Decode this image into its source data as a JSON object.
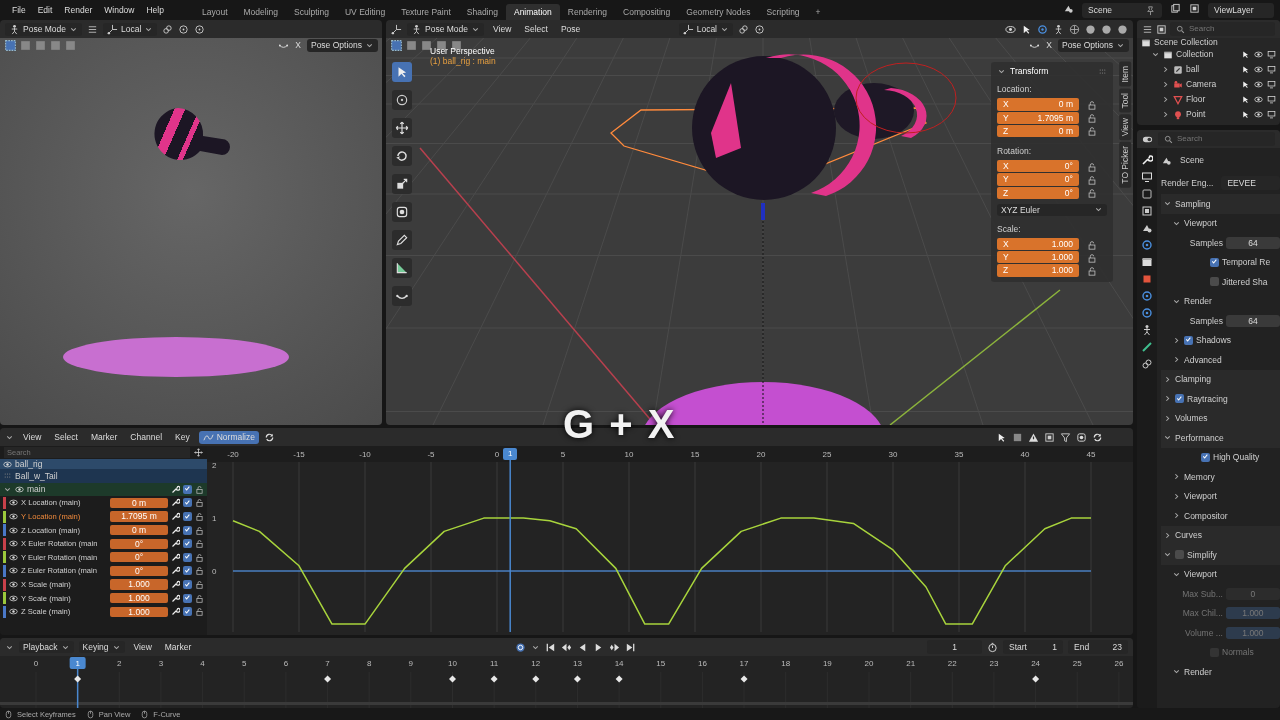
{
  "menu": [
    "File",
    "Edit",
    "Render",
    "Window",
    "Help"
  ],
  "workspaces": [
    {
      "label": "Layout",
      "selected": false
    },
    {
      "label": "Modeling",
      "selected": false
    },
    {
      "label": "Sculpting",
      "selected": false
    },
    {
      "label": "UV Editing",
      "selected": false
    },
    {
      "label": "Texture Paint",
      "selected": false
    },
    {
      "label": "Shading",
      "selected": false
    },
    {
      "label": "Animation",
      "selected": true
    },
    {
      "label": "Rendering",
      "selected": false
    },
    {
      "label": "Compositing",
      "selected": false
    },
    {
      "label": "Geometry Nodes",
      "selected": false
    },
    {
      "label": "Scripting",
      "selected": false
    }
  ],
  "add_workspace": "+",
  "scene": "Scene",
  "view_layer": "ViewLayer",
  "left_viewport": {
    "mode": "Pose Mode",
    "orientation": "Local",
    "mirror": "X",
    "pose_options": "Pose Options"
  },
  "main_viewport": {
    "mode": "Pose Mode",
    "menus": [
      "View",
      "Select",
      "Pose"
    ],
    "orientation": "Local",
    "mirror": "X",
    "pose_options": "Pose Options",
    "view_name": "User Perspective",
    "object_label": "(1) ball_rig : main",
    "side_tabs": [
      "Item",
      "Tool",
      "View",
      "TO Picker"
    ],
    "transform": {
      "title": "Transform",
      "groups": [
        {
          "label": "Location:",
          "fields": [
            {
              "axis": "X",
              "value": "0 m"
            },
            {
              "axis": "Y",
              "value": "1.7095 m"
            },
            {
              "axis": "Z",
              "value": "0 m"
            }
          ]
        },
        {
          "label": "Rotation:",
          "fields": [
            {
              "axis": "X",
              "value": "0°"
            },
            {
              "axis": "Y",
              "value": "0°"
            },
            {
              "axis": "Z",
              "value": "0°"
            }
          ],
          "mode": "XYZ Euler"
        },
        {
          "label": "Scale:",
          "fields": [
            {
              "axis": "X",
              "value": "1.000"
            },
            {
              "axis": "Y",
              "value": "1.000"
            },
            {
              "axis": "Z",
              "value": "1.000"
            }
          ]
        }
      ]
    }
  },
  "outliner": {
    "search_placeholder": "Search",
    "tree": [
      {
        "label": "Scene Collection",
        "kind": "scene_collection",
        "children": [
          {
            "label": "Collection",
            "kind": "collection",
            "expanded": true,
            "children": [
              {
                "label": "ball",
                "kind": "armature",
                "expanded": false
              },
              {
                "label": "Camera",
                "kind": "camera",
                "expanded": false
              },
              {
                "label": "Floor",
                "kind": "mesh",
                "expanded": false
              },
              {
                "label": "Point",
                "kind": "light",
                "expanded": false
              }
            ]
          }
        ]
      }
    ]
  },
  "properties": {
    "search_placeholder": "Search",
    "context": "Scene",
    "render_engine_label": "Render Eng...",
    "render_engine": "EEVEE",
    "panels": [
      {
        "kind": "panel",
        "label": "Sampling",
        "expanded": true,
        "children": [
          {
            "kind": "panel",
            "label": "Viewport",
            "expanded": true,
            "children": [
              {
                "kind": "field",
                "label": "Samples",
                "value": "64"
              },
              {
                "kind": "check",
                "label": "Temporal Re",
                "checked": true
              },
              {
                "kind": "check",
                "label": "Jittered Sha",
                "checked": false
              }
            ]
          },
          {
            "kind": "panel",
            "label": "Render",
            "expanded": true,
            "children": [
              {
                "kind": "field",
                "label": "Samples",
                "value": "64"
              }
            ]
          },
          {
            "kind": "panel",
            "label": "Shadows",
            "expanded": false,
            "checked": true
          },
          {
            "kind": "panel",
            "label": "Advanced",
            "expanded": false
          }
        ]
      },
      {
        "kind": "panel",
        "label": "Clamping",
        "expanded": false
      },
      {
        "kind": "panel",
        "label": "Raytracing",
        "expanded": false,
        "checked": true
      },
      {
        "kind": "panel",
        "label": "Volumes",
        "expanded": false
      },
      {
        "kind": "panel",
        "label": "Performance",
        "expanded": true,
        "children": [
          {
            "kind": "check",
            "label": "High Quality",
            "checked": true
          },
          {
            "kind": "panel",
            "label": "Memory",
            "expanded": false
          },
          {
            "kind": "panel",
            "label": "Viewport",
            "expanded": false
          },
          {
            "kind": "panel",
            "label": "Compositor",
            "expanded": false
          }
        ]
      },
      {
        "kind": "panel",
        "label": "Curves",
        "expanded": false
      },
      {
        "kind": "panel",
        "label": "Simplify",
        "expanded": true,
        "checked": false,
        "children": [
          {
            "kind": "panel",
            "label": "Viewport",
            "expanded": true,
            "children": [
              {
                "kind": "field",
                "label": "Max Sub...",
                "value": "0",
                "disabled": true
              },
              {
                "kind": "slider",
                "label": "Max Chil...",
                "value": "1.000",
                "level": 1,
                "disabled": true
              },
              {
                "kind": "slider",
                "label": "Volume ...",
                "value": "1.000",
                "level": 1,
                "disabled": true
              },
              {
                "kind": "check",
                "label": "Normals",
                "checked": false,
                "disabled": true
              }
            ]
          },
          {
            "kind": "panel",
            "label": "Render",
            "expanded": true
          }
        ]
      }
    ]
  },
  "graph": {
    "menus": [
      "View",
      "Select",
      "Marker",
      "Channel",
      "Key"
    ],
    "normalize": {
      "label": "Normalize",
      "on": true
    },
    "search_placeholder": "Search",
    "rig": "ball_rig",
    "action": "Ball_w_Tail",
    "group": {
      "name": "main",
      "expanded": true,
      "checked": true
    },
    "channels": [
      {
        "name": "X Location (main)",
        "value": "0 m",
        "color": "#c8404a",
        "selected": false,
        "checked": true
      },
      {
        "name": "Y Location (main)",
        "value": "1.7095 m",
        "color": "#9bc83c",
        "selected": true,
        "checked": true
      },
      {
        "name": "Z Location (main)",
        "value": "0 m",
        "color": "#4a78c8",
        "selected": false,
        "checked": true
      },
      {
        "name": "X Euler Rotation (main",
        "value": "0°",
        "color": "#c8404a",
        "selected": false,
        "checked": true
      },
      {
        "name": "Y Euler Rotation (main",
        "value": "0°",
        "color": "#9bc83c",
        "selected": false,
        "checked": true
      },
      {
        "name": "Z Euler Rotation (main",
        "value": "0°",
        "color": "#4a78c8",
        "selected": false,
        "checked": true
      },
      {
        "name": "X Scale (main)",
        "value": "1.000",
        "color": "#c8404a",
        "selected": false,
        "checked": true
      },
      {
        "name": "Y Scale (main)",
        "value": "1.000",
        "color": "#9bc83c",
        "selected": false,
        "checked": true
      },
      {
        "name": "Z Scale (main)",
        "value": "1.000",
        "color": "#4a78c8",
        "selected": false,
        "checked": true
      }
    ],
    "chart_data": {
      "type": "line",
      "x": [
        -20,
        -18,
        -15,
        -12.5,
        -10,
        -7,
        -4,
        -1,
        2,
        4,
        6,
        9,
        11.2,
        13,
        15.5,
        18.5,
        21.5,
        24,
        27,
        30,
        32.5,
        34,
        36,
        38.5,
        41.5,
        43.5,
        45
      ],
      "series": [
        {
          "color": "#a8d43c",
          "values": [
            0.95,
            0.75,
            0.1,
            -1,
            -1,
            0.05,
            0.75,
            1,
            1,
            0.95,
            0.8,
            0.05,
            -1,
            -1,
            0.05,
            0.75,
            1,
            1,
            0.9,
            0.4,
            -0.3,
            -1,
            -1,
            0.1,
            0.8,
            1,
            1
          ]
        },
        {
          "color": "#4a7fc0",
          "values": [
            0,
            0,
            0,
            0,
            0,
            0,
            0,
            0,
            0,
            0,
            0,
            0,
            0,
            0,
            0,
            0,
            0,
            0,
            0,
            0,
            0,
            0,
            0,
            0,
            0,
            0,
            0
          ]
        }
      ],
      "xlim": [
        -20,
        45
      ],
      "ylim": [
        -1.15,
        2.06
      ],
      "grid": true,
      "xticks": [
        -20,
        -15,
        -10,
        -5,
        0,
        5,
        10,
        15,
        20,
        25,
        30,
        35,
        40,
        45
      ],
      "yticks": [
        0,
        1,
        2
      ],
      "ref_lines": [
        {
          "axis": "x",
          "value": 1
        }
      ]
    },
    "current_frame": "1"
  },
  "timeline": {
    "menus": [
      "Playback",
      "Keying",
      "View",
      "Marker"
    ],
    "current_frame": "1",
    "start_label": "Start",
    "start": "1",
    "end_label": "End",
    "end": "23",
    "frames": [
      {
        "label": "0",
        "selected": false,
        "keyframe": false
      },
      {
        "label": "1",
        "selected": true,
        "keyframe": true
      },
      {
        "label": "2",
        "selected": false,
        "keyframe": false
      },
      {
        "label": "3",
        "selected": false,
        "keyframe": false
      },
      {
        "label": "4",
        "selected": false,
        "keyframe": false
      },
      {
        "label": "5",
        "selected": false,
        "keyframe": false
      },
      {
        "label": "6",
        "selected": false,
        "keyframe": false
      },
      {
        "label": "7",
        "selected": false,
        "keyframe": true
      },
      {
        "label": "8",
        "selected": false,
        "keyframe": false
      },
      {
        "label": "9",
        "selected": false,
        "keyframe": false
      },
      {
        "label": "10",
        "selected": false,
        "keyframe": true
      },
      {
        "label": "11",
        "selected": false,
        "keyframe": true
      },
      {
        "label": "12",
        "selected": false,
        "keyframe": true
      },
      {
        "label": "13",
        "selected": false,
        "keyframe": true
      },
      {
        "label": "14",
        "selected": false,
        "keyframe": true
      },
      {
        "label": "15",
        "selected": false,
        "keyframe": false
      },
      {
        "label": "16",
        "selected": false,
        "keyframe": false
      },
      {
        "label": "17",
        "selected": false,
        "keyframe": true
      },
      {
        "label": "18",
        "selected": false,
        "keyframe": false
      },
      {
        "label": "19",
        "selected": false,
        "keyframe": false
      },
      {
        "label": "20",
        "selected": false,
        "keyframe": false
      },
      {
        "label": "21",
        "selected": false,
        "keyframe": false
      },
      {
        "label": "22",
        "selected": false,
        "keyframe": false
      },
      {
        "label": "23",
        "selected": false,
        "keyframe": false
      },
      {
        "label": "24",
        "selected": false,
        "keyframe": true
      },
      {
        "label": "25",
        "selected": false,
        "keyframe": false
      },
      {
        "label": "26",
        "selected": false,
        "keyframe": false
      }
    ]
  },
  "status": [
    "Select Keyframes",
    "Pan View",
    "F-Curve"
  ],
  "keycast": "G + X"
}
